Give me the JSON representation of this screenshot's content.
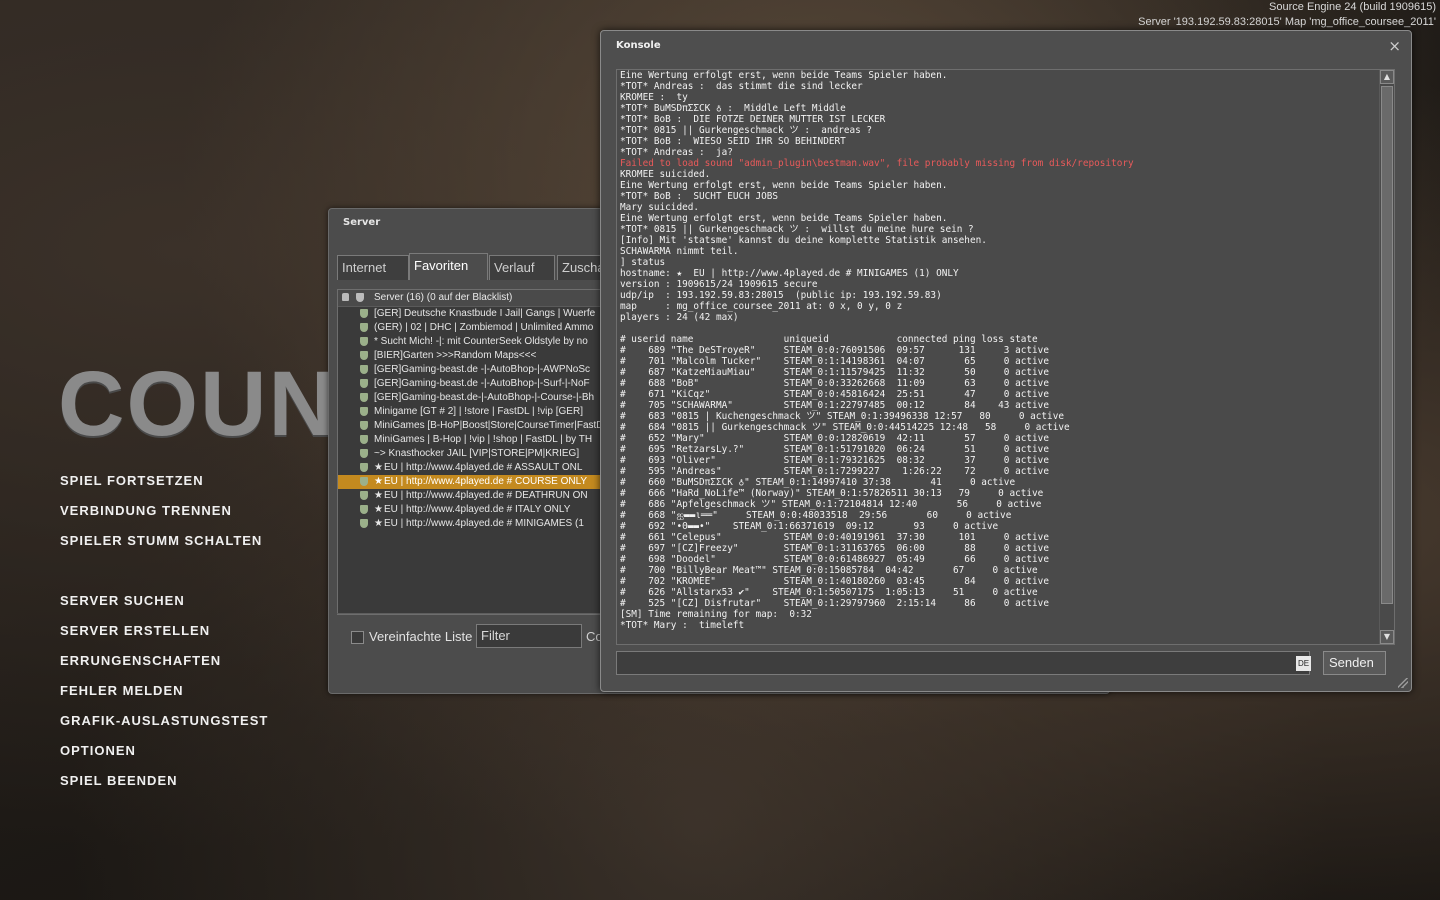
{
  "engine": {
    "version": "Source Engine 24 (build 1909615)",
    "server_line": "Server '193.192.59.83:28015' Map 'mg_office_coursee_2011'"
  },
  "logo_text": "COUN",
  "main_menu": {
    "group1": [
      "SPIEL FORTSETZEN",
      "VERBINDUNG TRENNEN",
      "SPIELER STUMM SCHALTEN"
    ],
    "group2": [
      "SERVER SUCHEN",
      "SERVER ERSTELLEN",
      "ERRUNGENSCHAFTEN",
      "FEHLER MELDEN",
      "GRAFIK-AUSLASTUNGSTEST",
      "OPTIONEN",
      "SPIEL BEENDEN"
    ]
  },
  "server_browser": {
    "title": "Server",
    "tabs": [
      "Internet",
      "Favoriten",
      "Verlauf",
      "Zuscha"
    ],
    "active_tab": "Favoriten",
    "header": "Server (16) (0 auf der Blacklist)",
    "rows": [
      {
        "fav": false,
        "name": "[GER] Deutsche Knastbude I Jail| Gangs | Wuerfe"
      },
      {
        "fav": false,
        "name": "(GER) | 02 | DHC | Zombiemod | Unlimited Ammo"
      },
      {
        "fav": false,
        "name": "* Sucht Mich! -|: mit CounterSeek Oldstyle by no"
      },
      {
        "fav": false,
        "name": "[BIER]Garten >>>Random Maps<<<"
      },
      {
        "fav": false,
        "name": "[GER]Gaming-beast.de -|-AutoBhop-|-AWPNoSc"
      },
      {
        "fav": false,
        "name": "[GER]Gaming-beast.de -|-AutoBhop-|-Surf-|-NoF"
      },
      {
        "fav": false,
        "name": "[GER]Gaming-beast.de-|-AutoBhop-|-Course-|-Bh"
      },
      {
        "fav": false,
        "name": "Minigame [GT # 2] | !store | FastDL | !vip [GER]"
      },
      {
        "fav": false,
        "name": "MiniGames [B-HoP|Boost|Store|CourseTimer|FastD"
      },
      {
        "fav": false,
        "name": "MiniGames | B-Hop | !vip | !shop | FastDL | by TH"
      },
      {
        "fav": false,
        "name": "~> Knasthocker JAIL [VIP|STORE|PM|KRIEG]"
      },
      {
        "fav": true,
        "name": "EU | http://www.4played.de # ASSAULT ONL"
      },
      {
        "fav": true,
        "name": "EU | http://www.4played.de # COURSE ONLY",
        "selected": true
      },
      {
        "fav": true,
        "name": "EU | http://www.4played.de # DEATHRUN ON"
      },
      {
        "fav": true,
        "name": "EU | http://www.4played.de # ITALY ONLY"
      },
      {
        "fav": true,
        "name": "EU | http://www.4played.de # MINIGAMES (1"
      }
    ],
    "star_glyph": "★",
    "simple_list_label": "Vereinfachte Liste",
    "filter_value": "Filter",
    "connect_label": "Co"
  },
  "console": {
    "title": "Konsole",
    "close_glyph": "×",
    "lines": [
      {
        "t": "Eine Wertung erfolgt erst, wenn beide Teams Spieler haben."
      },
      {
        "t": "*TOT* Andreas :  das stimmt die sind lecker"
      },
      {
        "t": "KROMEE :  ty"
      },
      {
        "t": "*TOT* BuMSDπΣΣCK ♁ :  Middle Left Middle"
      },
      {
        "t": "*TOT* BoB :  DIE FOTZE DEINER MUTTER IST LECKER"
      },
      {
        "t": "*TOT* 0815 || Gurkengeschmack ツ :  andreas ?"
      },
      {
        "t": "*TOT* BoB :  WIESO SEID IHR SO BEHINDERT"
      },
      {
        "t": "*TOT* Andreas :  ja?"
      },
      {
        "t": "Failed to load sound \"admin_plugin\\bestman.wav\", file probably missing from disk/repository",
        "error": true
      },
      {
        "t": "KROMEE suicided."
      },
      {
        "t": "Eine Wertung erfolgt erst, wenn beide Teams Spieler haben."
      },
      {
        "t": "*TOT* BoB :  SUCHT EUCH JOBS"
      },
      {
        "t": "Mary suicided."
      },
      {
        "t": "Eine Wertung erfolgt erst, wenn beide Teams Spieler haben."
      },
      {
        "t": "*TOT* 0815 || Gurkengeschmack ツ :  willst du meine hure sein ?"
      },
      {
        "t": "[Info] Mit 'statsme' kannst du deine komplette Statistik ansehen."
      },
      {
        "t": "SCHAWARMA nimmt teil."
      },
      {
        "t": "] status"
      },
      {
        "t": "hostname: ★  EU | http://www.4played.de # MINIGAMES (1) ONLY"
      },
      {
        "t": "version : 1909615/24 1909615 secure"
      },
      {
        "t": "udp/ip  : 193.192.59.83:28015  (public ip: 193.192.59.83)"
      },
      {
        "t": "map     : mg_office_coursee_2011 at: 0 x, 0 y, 0 z"
      },
      {
        "t": "players : 24 (42 max)"
      },
      {
        "t": ""
      },
      {
        "t": "# userid name                uniqueid            connected ping loss state"
      },
      {
        "t": "#    689 \"The DeSTroyeR\"     STEAM_0:0:76091506  09:57      131     3 active"
      },
      {
        "t": "#    701 \"Malcolm Tucker\"    STEAM_0:1:14198361  04:07       65     0 active"
      },
      {
        "t": "#    687 \"KatzeMiauMiau\"     STEAM_0:1:11579425  11:32       50     0 active"
      },
      {
        "t": "#    688 \"BoB\"               STEAM_0:0:33262668  11:09       63     0 active"
      },
      {
        "t": "#    671 \"KiCqz\"             STEAM_0:0:45816424  25:51       47     0 active"
      },
      {
        "t": "#    705 \"SCHAWARMA\"         STEAM_0:1:22797485  00:12       84    43 active"
      },
      {
        "t": "#    683 \"0815 | Kuchengeschmack ツ\" STEAM_0:1:39496338 12:57   80     0 active"
      },
      {
        "t": "#    684 \"0815 || Gurkengeschmack ツ\" STEAM_0:0:44514225 12:48   58     0 active"
      },
      {
        "t": "#    652 \"Mary\"              STEAM_0:0:12820619  42:11       57     0 active"
      },
      {
        "t": "#    695 \"RetzarsLy.?\"       STEAM_0:1:51791020  06:24       51     0 active"
      },
      {
        "t": "#    693 \"Oliver\"            STEAM_0:1:79321625  08:32       37     0 active"
      },
      {
        "t": "#    595 \"Andreas\"           STEAM_0:1:7299227    1:26:22    72     0 active"
      },
      {
        "t": "#    660 \"BuMSDπΣΣCK ♁\" STEAM_0:1:14997410 37:38       41     0 active"
      },
      {
        "t": "#    666 \"HaRd_NoLife™ (Norway)\" STEAM_0:1:57826511 30:13   79     0 active"
      },
      {
        "t": "#    686 \"Apfelgeschmack ツ\" STEAM_0:1:72104814 12:40       56     0 active"
      },
      {
        "t": "#    668 \"ஐ▬▬ι══\"     STEAM_0:0:48033518  29:56       60     0 active"
      },
      {
        "t": "#    692 \"•Θ▬▬•\"    STEAM_0:1:66371619  09:12       93     0 active"
      },
      {
        "t": "#    661 \"Celepus\"           STEAM_0:0:40191961  37:30      101     0 active"
      },
      {
        "t": "#    697 \"[CZ]Freezy\"        STEAM_0:1:31163765  06:00       88     0 active"
      },
      {
        "t": "#    698 \"Doodel\"            STEAM_0:0:61486927  05:49       66     0 active"
      },
      {
        "t": "#    700 \"BillyBear Meat™\" STEAM_0:0:15085784  04:42       67     0 active"
      },
      {
        "t": "#    702 \"KROMEE\"            STEAM_0:1:40180260  03:45       84     0 active"
      },
      {
        "t": "#    626 \"Allstarx53 ✔\"    STEAM_0:1:50507175  1:05:13     51     0 active"
      },
      {
        "t": "#    525 \"[CZ] Disfrutar\"    STEAM_0:1:29797960  2:15:14     86     0 active"
      },
      {
        "t": "[SM] Time remaining for map:  0:32"
      },
      {
        "t": "*TOT* Mary :  timeleft"
      }
    ],
    "input_value": "",
    "lang_badge": "DE",
    "send_label": "Senden",
    "scroll_up": "▲",
    "scroll_down": "▼"
  }
}
